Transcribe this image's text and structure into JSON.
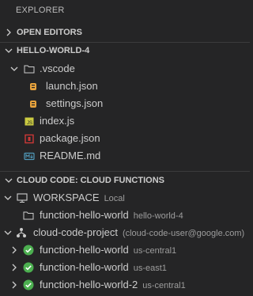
{
  "panel": {
    "title": "EXPLORER"
  },
  "open_editors": {
    "label": "OPEN EDITORS"
  },
  "workspace_section": {
    "label": "HELLO-WORLD-4"
  },
  "tree": {
    "vscode_folder": ".vscode",
    "launch_json": "launch.json",
    "settings_json": "settings.json",
    "index_js": "index.js",
    "package_json": "package.json",
    "readme": "README.md"
  },
  "cloud_section": {
    "label": "CLOUD CODE: CLOUD FUNCTIONS"
  },
  "workspace_node": {
    "label": "WORKSPACE",
    "desc": "Local"
  },
  "local_function": {
    "label": "function-hello-world",
    "desc": "hello-world-4"
  },
  "project": {
    "label": "cloud-code-project",
    "desc": "(cloud-code-user@google.com)"
  },
  "functions": [
    {
      "label": "function-hello-world",
      "region": "us-central1"
    },
    {
      "label": "function-hello-world",
      "region": "us-east1"
    },
    {
      "label": "function-hello-world-2",
      "region": "us-central1"
    }
  ],
  "colors": {
    "background": "#252526",
    "json_icon": "#e8a33d",
    "js_icon": "#cbcb41",
    "npm_icon": "#cb3837",
    "md_icon": "#519aba",
    "status_ok": "#4caf50"
  }
}
